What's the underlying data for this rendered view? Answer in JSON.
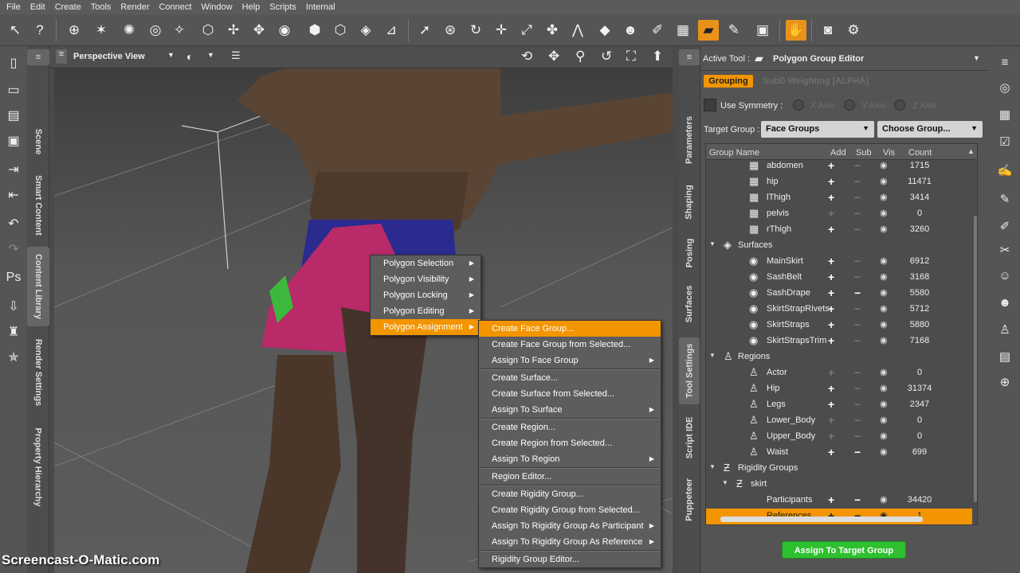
{
  "menubar": [
    "File",
    "Edit",
    "Create",
    "Tools",
    "Render",
    "Connect",
    "Window",
    "Help",
    "Scripts",
    "Internal"
  ],
  "viewport": {
    "title": "Perspective View"
  },
  "left_tabs": [
    "Scene",
    "Smart Content",
    "Content Library",
    "Render Settings",
    "Property Hierarchy"
  ],
  "right_tabs": [
    "Parameters",
    "Shaping",
    "Posing",
    "Surfaces",
    "Tool Settings",
    "Script IDE",
    "Puppeteer"
  ],
  "panel": {
    "active_tool_label": "Active Tool :",
    "active_tool_name": "Polygon Group Editor",
    "tab_grouping": "Grouping",
    "tab_subd": "SubD Weighting [ALPHA]",
    "use_symmetry": "Use Symmetry :",
    "x_axis": "X Axis",
    "y_axis": "Y Axis",
    "z_axis": "Z Axis",
    "target_group_label": "Target Group :",
    "target_group_value": "Face Groups",
    "choose_group": "Choose Group...",
    "columns": {
      "name": "Group Name",
      "add": "Add",
      "sub": "Sub",
      "vis": "Vis",
      "count": "Count"
    },
    "rows": [
      {
        "name": "abdomen",
        "count": "1715",
        "level": 2,
        "add": true,
        "sub": false
      },
      {
        "name": "hip",
        "count": "11471",
        "level": 2,
        "add": true,
        "sub": false
      },
      {
        "name": "lThigh",
        "count": "3414",
        "level": 2,
        "add": true,
        "sub": false
      },
      {
        "name": "pelvis",
        "count": "0",
        "level": 2,
        "add": false,
        "sub": false
      },
      {
        "name": "rThigh",
        "count": "3260",
        "level": 2,
        "add": true,
        "sub": false
      },
      {
        "name": "Surfaces",
        "level": 0,
        "header": true
      },
      {
        "name": "MainSkirt",
        "count": "6912",
        "level": 2,
        "add": true,
        "sub": false
      },
      {
        "name": "SashBelt",
        "count": "3168",
        "level": 2,
        "add": true,
        "sub": false
      },
      {
        "name": "SashDrape",
        "count": "5580",
        "level": 2,
        "add": true,
        "sub": true
      },
      {
        "name": "SkirtStrapRivets",
        "count": "5712",
        "level": 2,
        "add": true,
        "sub": false
      },
      {
        "name": "SkirtStraps",
        "count": "5880",
        "level": 2,
        "add": true,
        "sub": false
      },
      {
        "name": "SkirtStrapsTrim",
        "count": "7168",
        "level": 2,
        "add": true,
        "sub": false
      },
      {
        "name": "Regions",
        "level": 0,
        "header": true
      },
      {
        "name": "Actor",
        "count": "0",
        "level": 2,
        "add": false,
        "sub": false
      },
      {
        "name": "Hip",
        "count": "31374",
        "level": 2,
        "add": true,
        "sub": false
      },
      {
        "name": "Legs",
        "count": "2347",
        "level": 2,
        "add": true,
        "sub": false
      },
      {
        "name": "Lower_Body",
        "count": "0",
        "level": 2,
        "add": false,
        "sub": false
      },
      {
        "name": "Upper_Body",
        "count": "0",
        "level": 2,
        "add": false,
        "sub": false
      },
      {
        "name": "Waist",
        "count": "699",
        "level": 2,
        "add": true,
        "sub": true
      },
      {
        "name": "Rigidity Groups",
        "level": 0,
        "header": true
      },
      {
        "name": "skirt",
        "level": 1,
        "header": true
      },
      {
        "name": "Participants",
        "count": "34420",
        "level": 2,
        "add": true,
        "sub": true
      },
      {
        "name": "References",
        "count": "1",
        "level": 2,
        "add": true,
        "sub": true,
        "highlight": true
      }
    ],
    "assign_button": "Assign To Target Group"
  },
  "context_menu": [
    {
      "label": "Polygon Selection",
      "arrow": true
    },
    {
      "label": "Polygon Visibility",
      "arrow": true
    },
    {
      "label": "Polygon Locking",
      "arrow": true
    },
    {
      "label": "Polygon Editing",
      "arrow": true
    },
    {
      "label": "Polygon Assignment",
      "arrow": true,
      "selected": true
    }
  ],
  "submenu": [
    {
      "label": "Create Face Group...",
      "selected": true
    },
    {
      "label": "Create Face Group from Selected..."
    },
    {
      "label": "Assign To Face Group",
      "arrow": true
    },
    {
      "sep": true
    },
    {
      "label": "Create Surface..."
    },
    {
      "label": "Create Surface from Selected..."
    },
    {
      "label": "Assign To Surface",
      "arrow": true
    },
    {
      "sep": true
    },
    {
      "label": "Create Region..."
    },
    {
      "label": "Create Region from Selected..."
    },
    {
      "label": "Assign To Region",
      "arrow": true
    },
    {
      "sep": true
    },
    {
      "label": "Region Editor..."
    },
    {
      "sep": true
    },
    {
      "label": "Create Rigidity Group..."
    },
    {
      "label": "Create Rigidity Group from Selected..."
    },
    {
      "label": "Assign To Rigidity Group As Participant",
      "arrow": true
    },
    {
      "label": "Assign To Rigidity Group As Reference",
      "arrow": true
    },
    {
      "sep": true
    },
    {
      "label": "Rigidity Group Editor..."
    }
  ],
  "watermark": "Screencast-O-Matic.com",
  "colors": {
    "accent": "#f29500",
    "green_button": "#2fc02f"
  }
}
